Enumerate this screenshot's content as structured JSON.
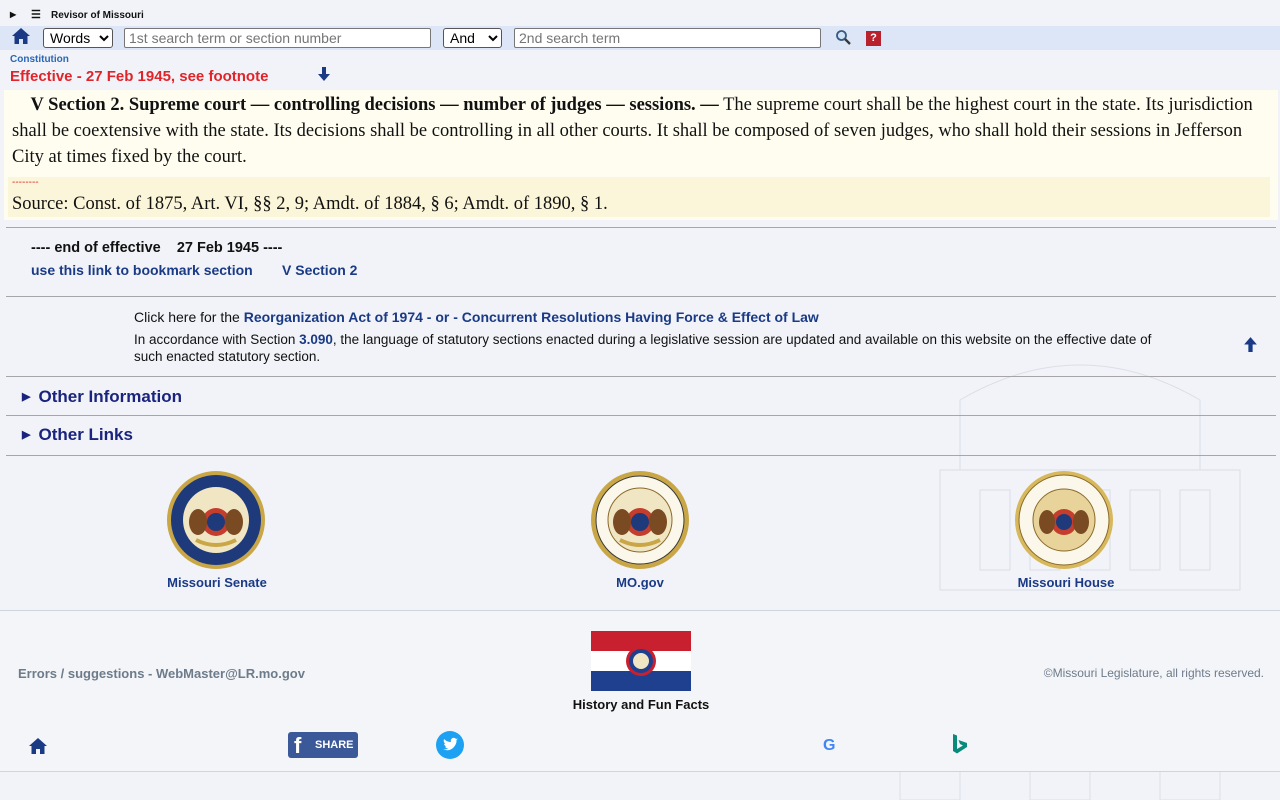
{
  "topbar": {
    "title": "Revisor of Missouri"
  },
  "search": {
    "mode_selected": "Words",
    "term1_placeholder": "1st search term or section number",
    "op_selected": "And",
    "term2_placeholder": "2nd search term",
    "help_label": "?"
  },
  "section": {
    "breadcrumb": "Constitution",
    "effective": "Effective - 27 Feb 1945, see footnote",
    "heading": "V Section 2.  Supreme court — controlling decisions — number of judges — sessions. —",
    "body": " The supreme court shall be the highest court in the state.  Its jurisdiction shall be coextensive with the state.  Its decisions shall be controlling in all other courts.  It shall be composed of seven judges, who shall hold their sessions in Jefferson City at times fixed by the court.",
    "divider": "--------",
    "source": "Source: Const. of 1875, Art. VI, §§ 2, 9; Amdt. of 1884, § 6; Amdt. of 1890, § 1."
  },
  "end_of_effective": "---- end of effective    27 Feb 1945 ----",
  "bookmark": {
    "label": "use this link to bookmark section",
    "section": "V Section 2"
  },
  "reorg": {
    "prefix": "Click here for the ",
    "link": "Reorganization Act of 1974 - or - Concurrent Resolutions Having Force & Effect of Law"
  },
  "accordance": {
    "prefix": "In accordance with Section ",
    "section": "3.090",
    "suffix": ", the language of statutory sections enacted during a legislative session are updated and available on this website on the effective date of such enacted statutory section."
  },
  "disclosures": {
    "other_info": "Other Information",
    "other_links": "Other Links"
  },
  "seals": [
    {
      "label": "Missouri Senate"
    },
    {
      "label": "MO.gov"
    },
    {
      "label": "Missouri House"
    }
  ],
  "footer": {
    "errors": "Errors / suggestions - WebMaster@LR.mo.gov",
    "history": "History and Fun Facts",
    "copyright": "©Missouri Legislature, all rights reserved.",
    "share_label": "SHARE",
    "google_label": "G"
  },
  "colors": {
    "accent": "#1a3a86",
    "effective": "#e0242a",
    "facebook": "#3b5998",
    "twitter": "#1da1f2"
  }
}
